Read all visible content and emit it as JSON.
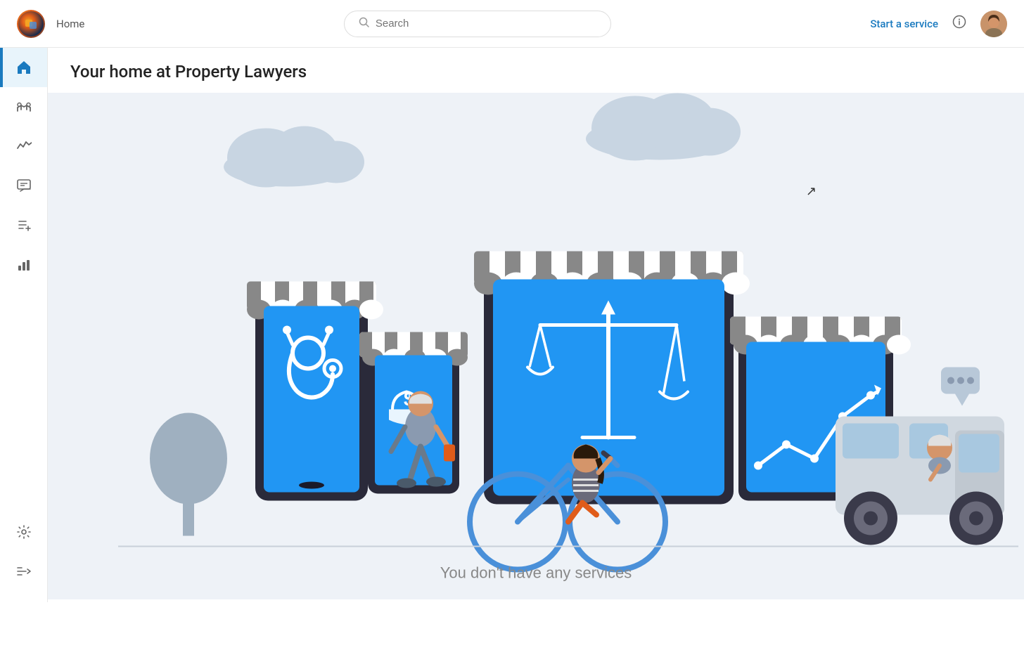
{
  "navbar": {
    "home_label": "Home",
    "search_placeholder": "Search",
    "start_service_label": "Start a service",
    "logo_alt": "App logo"
  },
  "sidebar": {
    "items": [
      {
        "name": "home",
        "icon": "⌂",
        "active": true
      },
      {
        "name": "handshake",
        "icon": "🤝",
        "active": false
      },
      {
        "name": "activity",
        "icon": "📈",
        "active": false
      },
      {
        "name": "chat",
        "icon": "💬",
        "active": false
      },
      {
        "name": "add-list",
        "icon": "📋",
        "active": false
      },
      {
        "name": "bar-chart",
        "icon": "📊",
        "active": false
      }
    ],
    "bottom_items": [
      {
        "name": "settings",
        "icon": "⚙"
      },
      {
        "name": "expand",
        "icon": "»"
      }
    ]
  },
  "main": {
    "page_title": "Your home at Property Lawyers",
    "hero_bottom_text": "You don't have any services"
  }
}
